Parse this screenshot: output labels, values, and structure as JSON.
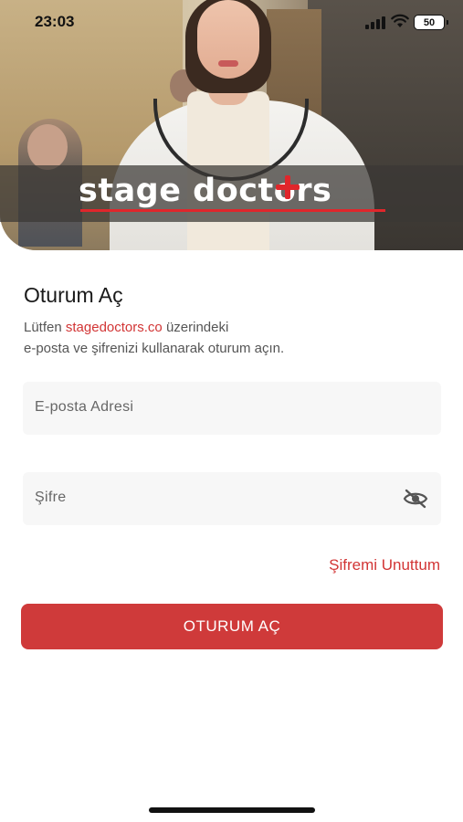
{
  "status_bar": {
    "time": "23:03",
    "battery": "50"
  },
  "hero": {
    "logo_text": "stage doctors",
    "accent": "#e0262b"
  },
  "form": {
    "title": "Oturum Aç",
    "subtitle_prefix": "Lütfen ",
    "subtitle_link": "stagedoctors.co",
    "subtitle_suffix": " üzerindeki",
    "subtitle_line2": "e-posta ve şifrenizi kullanarak oturum açın.",
    "email_placeholder": "E-posta Adresi",
    "password_placeholder": "Şifre",
    "forgot_label": "Şifremi Unuttum",
    "login_label": "OTURUM AÇ"
  },
  "icons": {
    "password_toggle": "eye-off-icon"
  },
  "colors": {
    "primary": "#cf3a3a",
    "link": "#d23535",
    "field_bg": "#f7f7f7"
  }
}
